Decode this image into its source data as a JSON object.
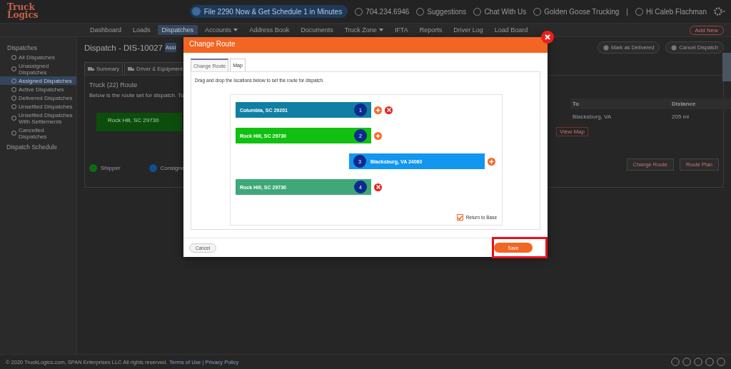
{
  "header": {
    "logo": "Truck Logics",
    "promo": "File 2290 Now & Get Schedule 1 in Minutes",
    "phone": "704.234.6946",
    "links": [
      "Suggestions",
      "Chat With Us",
      "Golden Goose Trucking"
    ],
    "separator": "|",
    "user": "Hi Caleb Flachman"
  },
  "nav": {
    "items": [
      {
        "label": "Dashboard",
        "selected": false,
        "dropdown": false
      },
      {
        "label": "Loads",
        "selected": false,
        "dropdown": false
      },
      {
        "label": "Dispatches",
        "selected": true,
        "dropdown": false
      },
      {
        "label": "Accounts",
        "selected": false,
        "dropdown": true
      },
      {
        "label": "Address Book",
        "selected": false,
        "dropdown": false
      },
      {
        "label": "Documents",
        "selected": false,
        "dropdown": false
      },
      {
        "label": "Truck Zone",
        "selected": false,
        "dropdown": true
      },
      {
        "label": "IFTA",
        "selected": false,
        "dropdown": false
      },
      {
        "label": "Reports",
        "selected": false,
        "dropdown": false
      },
      {
        "label": "Driver Log",
        "selected": false,
        "dropdown": false
      },
      {
        "label": "Load Board",
        "selected": false,
        "dropdown": false
      }
    ],
    "add_button": "Add New"
  },
  "sidebar": {
    "heading": "Dispatches",
    "items": [
      {
        "label": "All Dispatches",
        "selected": false
      },
      {
        "label": "Unassigned Dispatches",
        "selected": false
      },
      {
        "label": "Assigned Dispatches",
        "selected": true
      },
      {
        "label": "Active Dispatches",
        "selected": false
      },
      {
        "label": "Delivered Dispatches",
        "selected": false
      },
      {
        "label": "Unsettled Dispatches",
        "selected": false
      },
      {
        "label": "Unsettled Dispatches With Settlements",
        "selected": false
      },
      {
        "label": "Cancelled Dispatches",
        "selected": false
      }
    ],
    "footer_link": "Dispatch Schedule"
  },
  "main": {
    "title": "Dispatch - DIS-10027",
    "status_badge": "Assi",
    "actions": [
      "Mark as Delivered",
      "Cancel Dispatch"
    ],
    "tabs": [
      {
        "label": "Summary",
        "selected": false
      },
      {
        "label": "Driver & Equipment",
        "selected": false
      }
    ],
    "card_title": "Truck (22) Route",
    "card_text": "Below is the route set for dispatch. To",
    "route_block": "Rock Hill, SC 29730",
    "table": {
      "columns": [
        "To",
        "Distance"
      ],
      "rows": [
        [
          "Blacksburg, VA",
          "205 mi"
        ]
      ]
    },
    "view_map": "View Map",
    "legend": [
      {
        "label": "Shipper",
        "color": "#0f6b0f"
      },
      {
        "label": "Consigne",
        "color": "#0e4f8f"
      }
    ],
    "buttons": [
      "Change Route",
      "Route Plan"
    ]
  },
  "footer": {
    "copyright": "© 2020 TruckLogics.com, SPAN Enterprises LLC All rights reserved.",
    "links": [
      "Terms of Use",
      "Privacy Policy"
    ],
    "separator": "|"
  },
  "modal": {
    "title": "Change Route",
    "tabs": [
      {
        "label": "Change Route",
        "selected": true
      },
      {
        "label": "Map",
        "selected": false
      }
    ],
    "instruction": "Drag and drop the locations below to set the route for dispatch.",
    "stops": [
      {
        "location": "Columbia, SC 29201",
        "number": "1",
        "color": "#117fa3",
        "offset": false,
        "can_add": true,
        "can_remove": true
      },
      {
        "location": "Rock Hill, SC 29730",
        "number": "2",
        "color": "#12c012",
        "offset": false,
        "can_add": true,
        "can_remove": false
      },
      {
        "location": "Blacksburg, VA 24060",
        "number": "3",
        "color": "#1296f0",
        "offset": true,
        "can_add": true,
        "can_remove": false
      },
      {
        "location": "Rock Hill, SC 29730",
        "number": "4",
        "color": "#3fa878",
        "offset": false,
        "can_add": false,
        "can_remove": true
      }
    ],
    "return_to_base": {
      "label": "Return to Base",
      "checked": true
    },
    "cancel": "Cancel",
    "save": {
      "label": "Save",
      "highlighted": true
    }
  }
}
